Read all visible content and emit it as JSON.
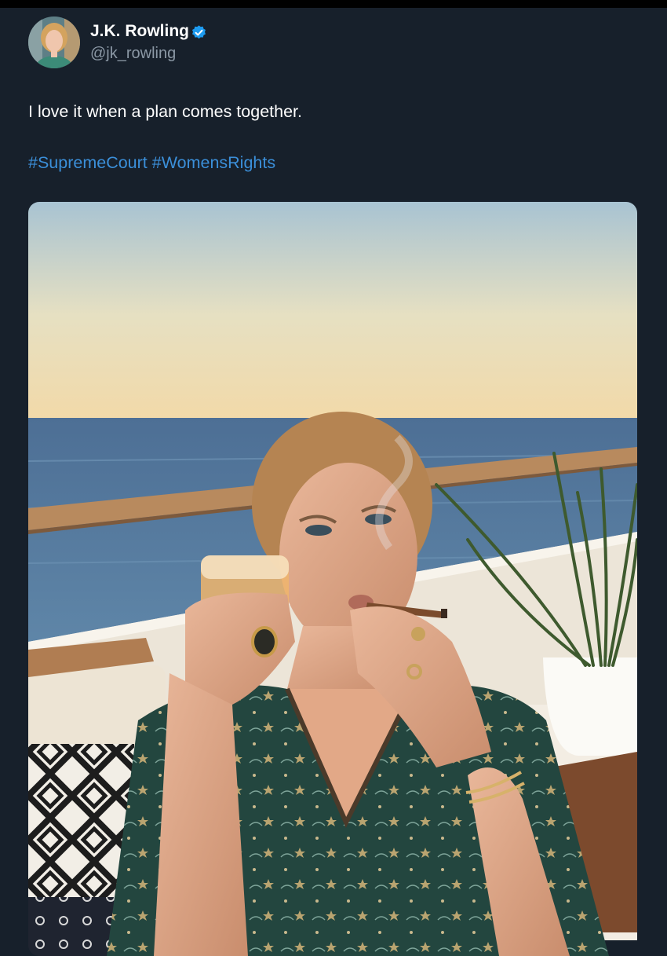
{
  "tweet": {
    "author": {
      "name": "J.K. Rowling",
      "handle": "@jk_rowling",
      "verified_icon": "verified-badge-icon",
      "verified_color": "#1d9bf0"
    },
    "text": "I love it when a plan comes together.",
    "hashtags": [
      "#SupremeCourt",
      "#WomensRights"
    ],
    "link_color": "#3b8fd9"
  }
}
